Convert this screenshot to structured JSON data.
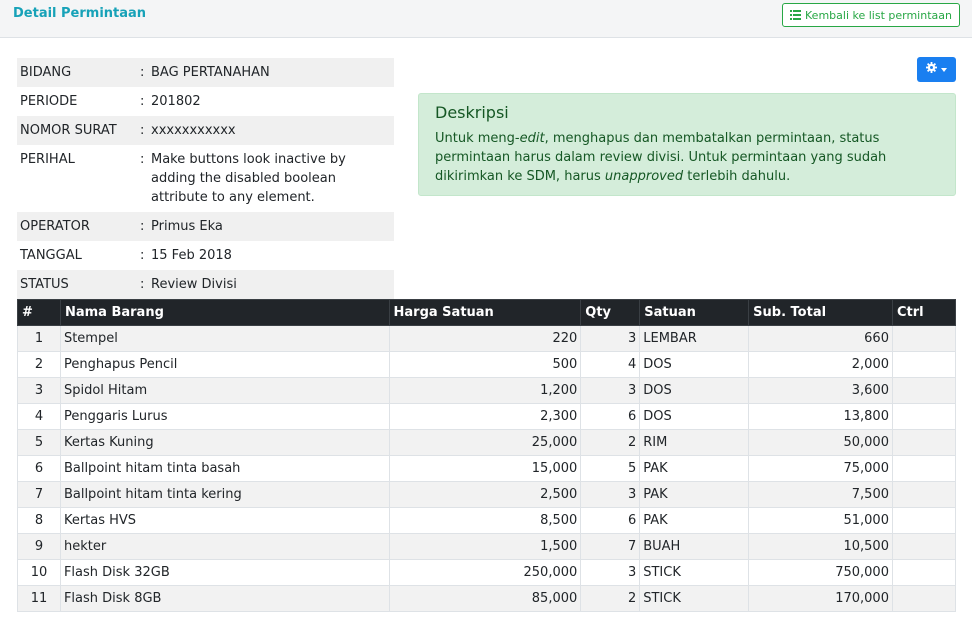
{
  "header": {
    "title": "Detail Permintaan",
    "back_label": "Kembali ke list permintaan"
  },
  "icons": {
    "back": "list-icon",
    "settings": "gear-icon"
  },
  "colors": {
    "accent": "#17a2b8",
    "success": "#28a745",
    "primary": "#1a7ff0",
    "table_header": "#212529"
  },
  "info": {
    "rows": [
      {
        "label": "BIDANG",
        "sep": ":",
        "value": "BAG PERTANAHAN"
      },
      {
        "label": "PERIODE",
        "sep": ":",
        "value": "201802"
      },
      {
        "label": "NOMOR SURAT",
        "sep": ":",
        "value": "xxxxxxxxxxx"
      },
      {
        "label": "PERIHAL",
        "sep": ":",
        "value": "Make buttons look inactive by adding the disabled boolean attribute to any element."
      },
      {
        "label": "OPERATOR",
        "sep": ":",
        "value": "Primus Eka"
      },
      {
        "label": "TANGGAL",
        "sep": ":",
        "value": "15 Feb 2018"
      },
      {
        "label": "STATUS",
        "sep": ":",
        "value": "Review Divisi"
      }
    ]
  },
  "alert": {
    "title": "Deskripsi",
    "t1": "Untuk meng-",
    "t2": "edit",
    "t3": ", menghapus dan membatalkan permintaan, status permintaan harus dalam review divisi. Untuk permintaan yang sudah dikirimkan ke SDM, harus ",
    "t4": "unapproved",
    "t5": " terlebih dahulu."
  },
  "table": {
    "headers": [
      "#",
      "Nama Barang",
      "Harga Satuan",
      "Qty",
      "Satuan",
      "Sub. Total",
      "Ctrl"
    ],
    "rows": [
      {
        "no": "1",
        "nama": "Stempel",
        "harga": "220",
        "qty": "3",
        "satuan": "LEMBAR",
        "subtotal": "660",
        "ctrl": ""
      },
      {
        "no": "2",
        "nama": "Penghapus Pencil",
        "harga": "500",
        "qty": "4",
        "satuan": "DOS",
        "subtotal": "2,000",
        "ctrl": ""
      },
      {
        "no": "3",
        "nama": "Spidol Hitam",
        "harga": "1,200",
        "qty": "3",
        "satuan": "DOS",
        "subtotal": "3,600",
        "ctrl": ""
      },
      {
        "no": "4",
        "nama": "Penggaris Lurus",
        "harga": "2,300",
        "qty": "6",
        "satuan": "DOS",
        "subtotal": "13,800",
        "ctrl": ""
      },
      {
        "no": "5",
        "nama": "Kertas Kuning",
        "harga": "25,000",
        "qty": "2",
        "satuan": "RIM",
        "subtotal": "50,000",
        "ctrl": ""
      },
      {
        "no": "6",
        "nama": "Ballpoint hitam tinta basah",
        "harga": "15,000",
        "qty": "5",
        "satuan": "PAK",
        "subtotal": "75,000",
        "ctrl": ""
      },
      {
        "no": "7",
        "nama": "Ballpoint hitam tinta kering",
        "harga": "2,500",
        "qty": "3",
        "satuan": "PAK",
        "subtotal": "7,500",
        "ctrl": ""
      },
      {
        "no": "8",
        "nama": "Kertas HVS",
        "harga": "8,500",
        "qty": "6",
        "satuan": "PAK",
        "subtotal": "51,000",
        "ctrl": ""
      },
      {
        "no": "9",
        "nama": "hekter",
        "harga": "1,500",
        "qty": "7",
        "satuan": "BUAH",
        "subtotal": "10,500",
        "ctrl": ""
      },
      {
        "no": "10",
        "nama": "Flash Disk 32GB",
        "harga": "250,000",
        "qty": "3",
        "satuan": "STICK",
        "subtotal": "750,000",
        "ctrl": ""
      },
      {
        "no": "11",
        "nama": "Flash Disk 8GB",
        "harga": "85,000",
        "qty": "2",
        "satuan": "STICK",
        "subtotal": "170,000",
        "ctrl": ""
      }
    ]
  }
}
